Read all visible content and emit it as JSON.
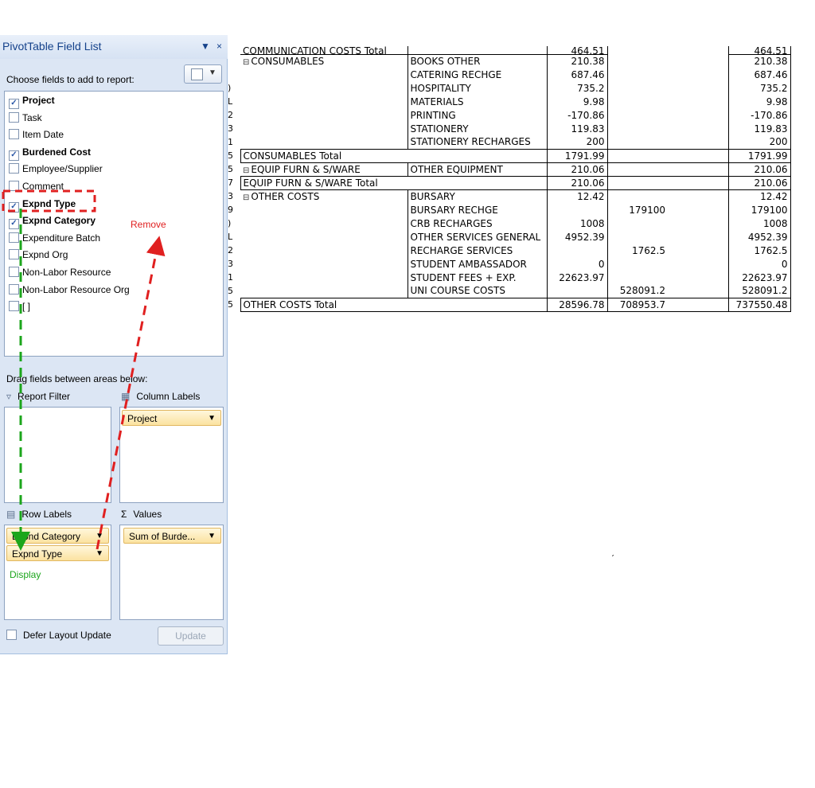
{
  "panel": {
    "title": "PivotTable Field List",
    "title_dropdown": "▼",
    "title_close": "×",
    "choose_label": "Choose fields to add to report:",
    "layout_button_arrow": "▼",
    "fields": [
      {
        "label": "Project",
        "checked": true,
        "bold": true
      },
      {
        "label": "Task",
        "checked": false,
        "bold": false
      },
      {
        "label": "Item Date",
        "checked": false,
        "bold": false
      },
      {
        "label": "Burdened Cost",
        "checked": true,
        "bold": true
      },
      {
        "label": "Employee/Supplier",
        "checked": false,
        "bold": false
      },
      {
        "label": "Comment",
        "checked": false,
        "bold": false
      },
      {
        "label": "Expnd Type",
        "checked": true,
        "bold": true
      },
      {
        "label": "Expnd Category",
        "checked": true,
        "bold": true
      },
      {
        "label": "Expenditure Batch",
        "checked": false,
        "bold": false
      },
      {
        "label": "Expnd Org",
        "checked": false,
        "bold": false
      },
      {
        "label": "Non-Labor Resource",
        "checked": false,
        "bold": false
      },
      {
        "label": "Non-Labor Resource Org",
        "checked": false,
        "bold": false
      },
      {
        "label": "[ ]",
        "checked": false,
        "bold": false
      }
    ],
    "drag_label": "Drag fields between areas below:",
    "areas": {
      "report_filter": "Report Filter",
      "column_labels": "Column Labels",
      "row_labels": "Row Labels",
      "values": "Values"
    },
    "column_pills": [
      "Project"
    ],
    "row_pills": [
      "Expnd Category",
      "Expnd Type"
    ],
    "value_pills": [
      "Sum of Burde..."
    ],
    "defer_label": "Defer Layout Update",
    "update_label": "Update",
    "annotations": {
      "remove": "Remove",
      "display": "Display"
    }
  },
  "sheet": {
    "rows": [
      {
        "rn": "",
        "a": "COMMUNICATION COSTS Total",
        "b": "",
        "v1": "464.51",
        "v2": "",
        "v3": "",
        "t": "464.51",
        "kind": "total-cut",
        "exp": false
      },
      {
        "rn": "",
        "a": "CONSUMABLES",
        "b": "BOOKS OTHER",
        "v1": "210.38",
        "v2": "",
        "v3": "",
        "t": "210.38",
        "kind": "grp",
        "exp": true
      },
      {
        "rn": "",
        "a": "",
        "b": "CATERING RECHGE",
        "v1": "687.46",
        "v2": "",
        "v3": "",
        "t": "687.46",
        "kind": "",
        "exp": false
      },
      {
        "rn": ")",
        "a": "",
        "b": "HOSPITALITY",
        "v1": "735.2",
        "v2": "",
        "v3": "",
        "t": "735.2",
        "kind": "",
        "exp": false
      },
      {
        "rn": "L",
        "a": "",
        "b": "MATERIALS",
        "v1": "9.98",
        "v2": "",
        "v3": "",
        "t": "9.98",
        "kind": "",
        "exp": false
      },
      {
        "rn": "2",
        "a": "",
        "b": "PRINTING",
        "v1": "-170.86",
        "v2": "",
        "v3": "",
        "t": "-170.86",
        "kind": "",
        "exp": false
      },
      {
        "rn": "3",
        "a": "",
        "b": "STATIONERY",
        "v1": "119.83",
        "v2": "",
        "v3": "",
        "t": "119.83",
        "kind": "",
        "exp": false
      },
      {
        "rn": "1",
        "a": "",
        "b": "STATIONERY RECHARGES",
        "v1": "200",
        "v2": "",
        "v3": "",
        "t": "200",
        "kind": "",
        "exp": false
      },
      {
        "rn": "5",
        "a": "CONSUMABLES Total",
        "b": "",
        "v1": "1791.99",
        "v2": "",
        "v3": "",
        "t": "1791.99",
        "kind": "total",
        "exp": false
      },
      {
        "rn": "5",
        "a": "EQUIP FURN & S/WARE",
        "b": "OTHER EQUIPMENT",
        "v1": "210.06",
        "v2": "",
        "v3": "",
        "t": "210.06",
        "kind": "grp",
        "exp": true
      },
      {
        "rn": "7",
        "a": "EQUIP FURN & S/WARE Total",
        "b": "",
        "v1": "210.06",
        "v2": "",
        "v3": "",
        "t": "210.06",
        "kind": "total",
        "exp": false
      },
      {
        "rn": "3",
        "a": "OTHER COSTS",
        "b": "BURSARY",
        "v1": "12.42",
        "v2": "",
        "v3": "",
        "t": "12.42",
        "kind": "grp",
        "exp": true
      },
      {
        "rn": "9",
        "a": "",
        "b": "BURSARY RECHGE",
        "v1": "",
        "v2": "179100",
        "v3": "",
        "t": "179100",
        "kind": "",
        "exp": false
      },
      {
        "rn": ")",
        "a": "",
        "b": "CRB RECHARGES",
        "v1": "1008",
        "v2": "",
        "v3": "",
        "t": "1008",
        "kind": "",
        "exp": false
      },
      {
        "rn": "L",
        "a": "",
        "b": "OTHER SERVICES GENERAL",
        "v1": "4952.39",
        "v2": "",
        "v3": "",
        "t": "4952.39",
        "kind": "",
        "exp": false
      },
      {
        "rn": "2",
        "a": "",
        "b": "RECHARGE SERVICES",
        "v1": "",
        "v2": "1762.5",
        "v3": "",
        "t": "1762.5",
        "kind": "",
        "exp": false
      },
      {
        "rn": "3",
        "a": "",
        "b": "STUDENT AMBASSADOR",
        "v1": "0",
        "v2": "",
        "v3": "",
        "t": "0",
        "kind": "",
        "exp": false
      },
      {
        "rn": "1",
        "a": "",
        "b": "STUDENT FEES + EXP.",
        "v1": "22623.97",
        "v2": "",
        "v3": "",
        "t": "22623.97",
        "kind": "",
        "exp": false
      },
      {
        "rn": "5",
        "a": "",
        "b": "UNI COURSE COSTS",
        "v1": "",
        "v2": "528091.2",
        "v3": "",
        "t": "528091.2",
        "kind": "",
        "exp": false
      },
      {
        "rn": "5",
        "a": "OTHER COSTS Total",
        "b": "",
        "v1": "28596.78",
        "v2": "708953.7",
        "v3": "",
        "t": "737550.48",
        "kind": "total",
        "exp": false
      }
    ]
  },
  "colors": {
    "remove_arrow": "#e02020",
    "display_arrow": "#1ca61c",
    "pill": "#fbe2a0"
  },
  "misc": {
    "stray_mark": "ˊ"
  }
}
